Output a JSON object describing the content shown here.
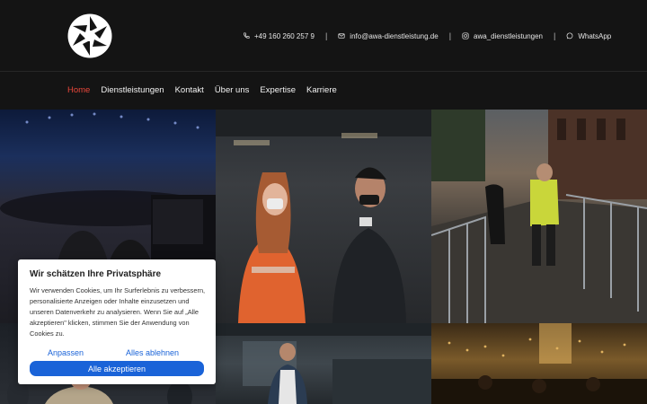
{
  "header": {
    "logo_icon": "camera-aperture-icon",
    "contacts": {
      "phone": "+49 160 260 257 9",
      "email": "info@awa-dienstleistung.de",
      "instagram": "awa_dienstleistungen",
      "whatsapp": "WhatsApp"
    },
    "separator": "|"
  },
  "nav": {
    "items": [
      {
        "label": "Home",
        "active": true
      },
      {
        "label": "Dienstleistungen"
      },
      {
        "label": "Kontakt"
      },
      {
        "label": "Über uns"
      },
      {
        "label": "Expertise"
      },
      {
        "label": "Karriere"
      }
    ],
    "active_color": "#e8473a"
  },
  "cookie_banner": {
    "title": "Wir schätzen Ihre Privatsphäre",
    "text": "Wir verwenden Cookies, um Ihr Surferlebnis zu verbessern, personalisierte Anzeigen oder Inhalte einzusetzen und unseren Datenverkehr zu analysieren. Wenn Sie auf „Alle akzeptieren\" klicken, stimmen Sie der Anwendung von Cookies zu.",
    "customize_label": "Anpassen",
    "reject_label": "Alles ablehnen",
    "accept_label": "Alle akzeptieren",
    "accent_color": "#1a63d8"
  }
}
